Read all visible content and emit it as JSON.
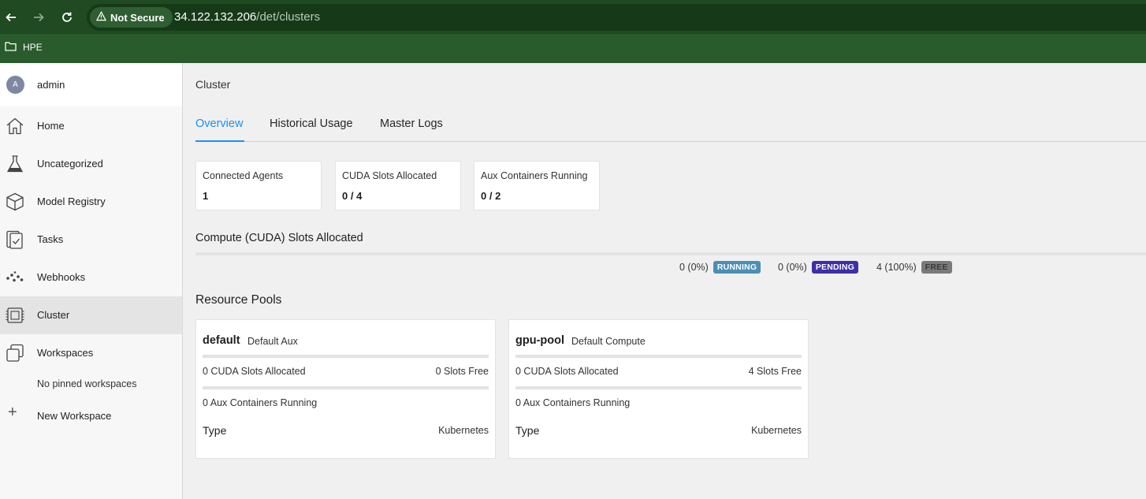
{
  "browser": {
    "security_label": "Not Secure",
    "url_host": "34.122.132.206",
    "url_path": "/det/clusters",
    "bookmark_label": "HPE"
  },
  "sidebar": {
    "avatar_initial": "A",
    "user_name": "admin",
    "items": [
      {
        "label": "Home",
        "icon": "home-icon"
      },
      {
        "label": "Uncategorized",
        "icon": "flask-icon"
      },
      {
        "label": "Model Registry",
        "icon": "cube-icon"
      },
      {
        "label": "Tasks",
        "icon": "tasks-icon"
      },
      {
        "label": "Webhooks",
        "icon": "webhooks-icon"
      },
      {
        "label": "Cluster",
        "icon": "cluster-chip-icon"
      },
      {
        "label": "Workspaces",
        "icon": "workspaces-icon"
      }
    ],
    "no_pinned": "No pinned workspaces",
    "new_workspace": "New Workspace"
  },
  "main": {
    "breadcrumb": "Cluster",
    "tabs": [
      "Overview",
      "Historical Usage",
      "Master Logs"
    ],
    "active_tab": "Overview",
    "stats": [
      {
        "title": "Connected Agents",
        "value": "1"
      },
      {
        "title": "CUDA Slots Allocated",
        "value": "0 / 4"
      },
      {
        "title": "Aux Containers Running",
        "value": "0 / 2"
      }
    ],
    "compute_title": "Compute (CUDA) Slots Allocated",
    "legend": [
      {
        "count": "0 (0%)",
        "label": "RUNNING",
        "color": "#4a8fb5"
      },
      {
        "count": "0 (0%)",
        "label": "PENDING",
        "color": "#3d2fa8"
      },
      {
        "count": "4 (100%)",
        "label": "FREE",
        "color": "#7a7a7a"
      }
    ],
    "pools_title": "Resource Pools",
    "pools": [
      {
        "name": "default",
        "kind": "Default Aux",
        "cuda_allocated": "0 CUDA Slots Allocated",
        "slots_free": "0 Slots Free",
        "aux_running": "0 Aux Containers Running",
        "type_label": "Type",
        "type_value": "Kubernetes"
      },
      {
        "name": "gpu-pool",
        "kind": "Default Compute",
        "cuda_allocated": "0 CUDA Slots Allocated",
        "slots_free": "4 Slots Free",
        "aux_running": "0 Aux Containers Running",
        "type_label": "Type",
        "type_value": "Kubernetes"
      }
    ]
  }
}
